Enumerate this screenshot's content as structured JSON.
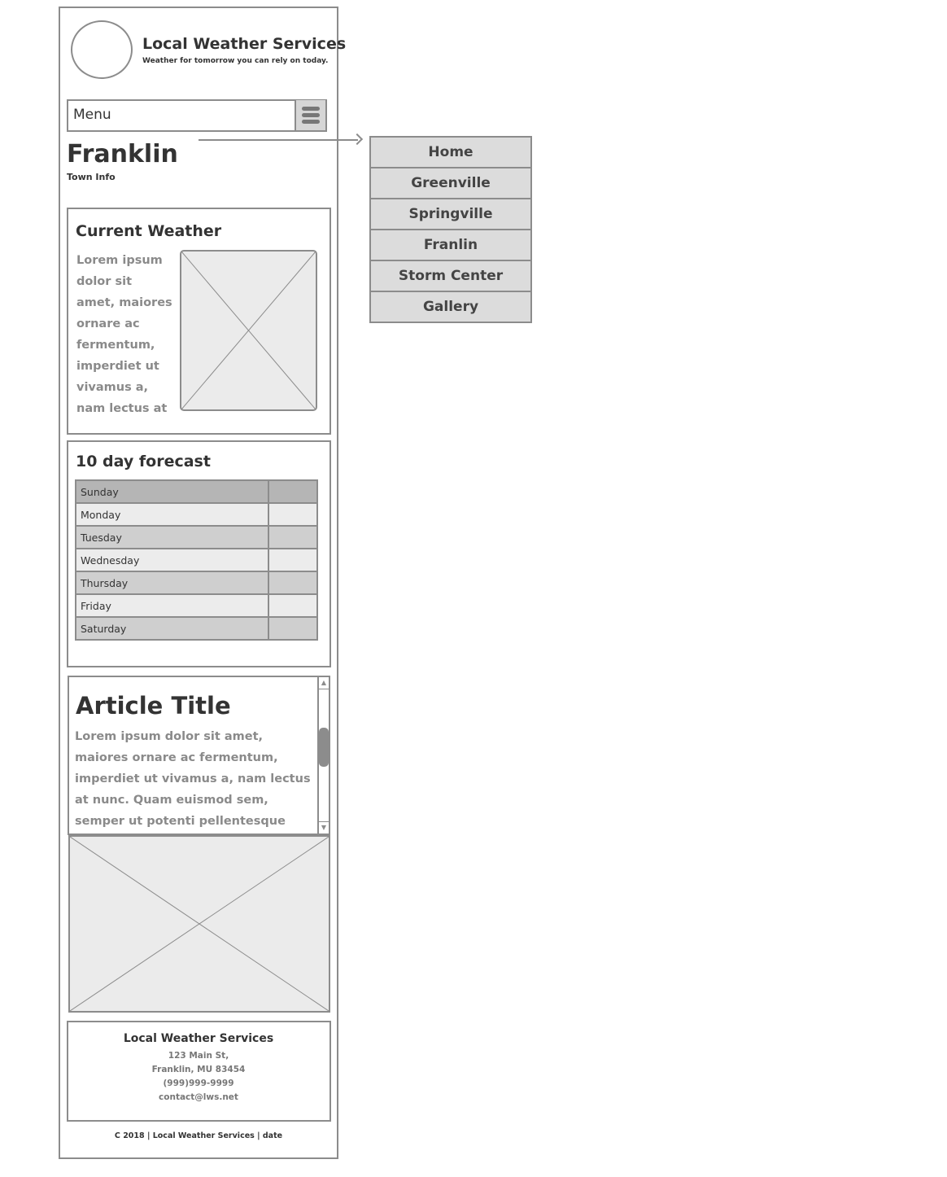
{
  "header": {
    "site_title": "Local Weather Services",
    "tagline": "Weather for tomorrow you can rely on today."
  },
  "menu": {
    "label": "Menu",
    "toggle_icon": "hamburger-icon",
    "items": [
      "Home",
      "Greenville",
      "Springville",
      "Franlin",
      "Storm Center",
      "Gallery"
    ]
  },
  "page": {
    "title": "Franklin",
    "subtitle": "Town Info"
  },
  "current_weather": {
    "title": "Current Weather",
    "text": "Lorem ipsum dolor sit amet, maiores ornare ac fermentum, imperdiet ut vivamus a, nam lectus at nunc. Quam euismod"
  },
  "forecast": {
    "title": "10 day forecast",
    "days": [
      "Sunday",
      "Monday",
      "Tuesday",
      "Wednesday",
      "Thursday",
      "Friday",
      "Saturday"
    ]
  },
  "article": {
    "title": "Article Title",
    "text": "Lorem ipsum dolor sit amet, maiores ornare ac fermentum, imperdiet ut vivamus a, nam lectus at nunc. Quam euismod sem, semper ut potenti pellentesque quisque. In eget sapien sed,"
  },
  "footer": {
    "title": "Local Weather Services",
    "address1": "123 Main St,",
    "address2": "Franklin, MU 83454",
    "phone": "(999)999-9999",
    "email": "contact@lws.net",
    "copyright": "C 2018 | Local Weather Services | date"
  },
  "colors": {
    "border": "#8c8c8c",
    "placeholder_fill": "#ebebeb",
    "menu_item_fill": "#dcdcdc",
    "text": "#333333",
    "muted_text": "#8a8a8a"
  }
}
